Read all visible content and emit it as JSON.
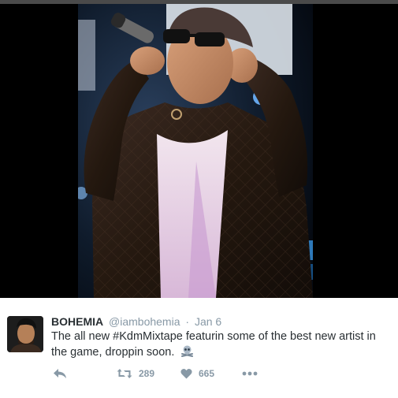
{
  "tweet": {
    "display_name": "BOHEMIA",
    "handle": "@iambohemia",
    "separator": "·",
    "timestamp": "Jan 6",
    "text": "The all new #KdmMixtape featurin some of the best new artist in the game, droppin soon.",
    "emoji": "skull-and-crossbones",
    "actions": {
      "reply_icon": "reply-icon",
      "retweet_icon": "retweet-icon",
      "retweet_count": "289",
      "like_icon": "heart-icon",
      "like_count": "665",
      "more_icon": "more-dots-icon"
    }
  },
  "colors": {
    "text": "#292f33",
    "meta": "#8899a6",
    "media_background": "#000000"
  }
}
